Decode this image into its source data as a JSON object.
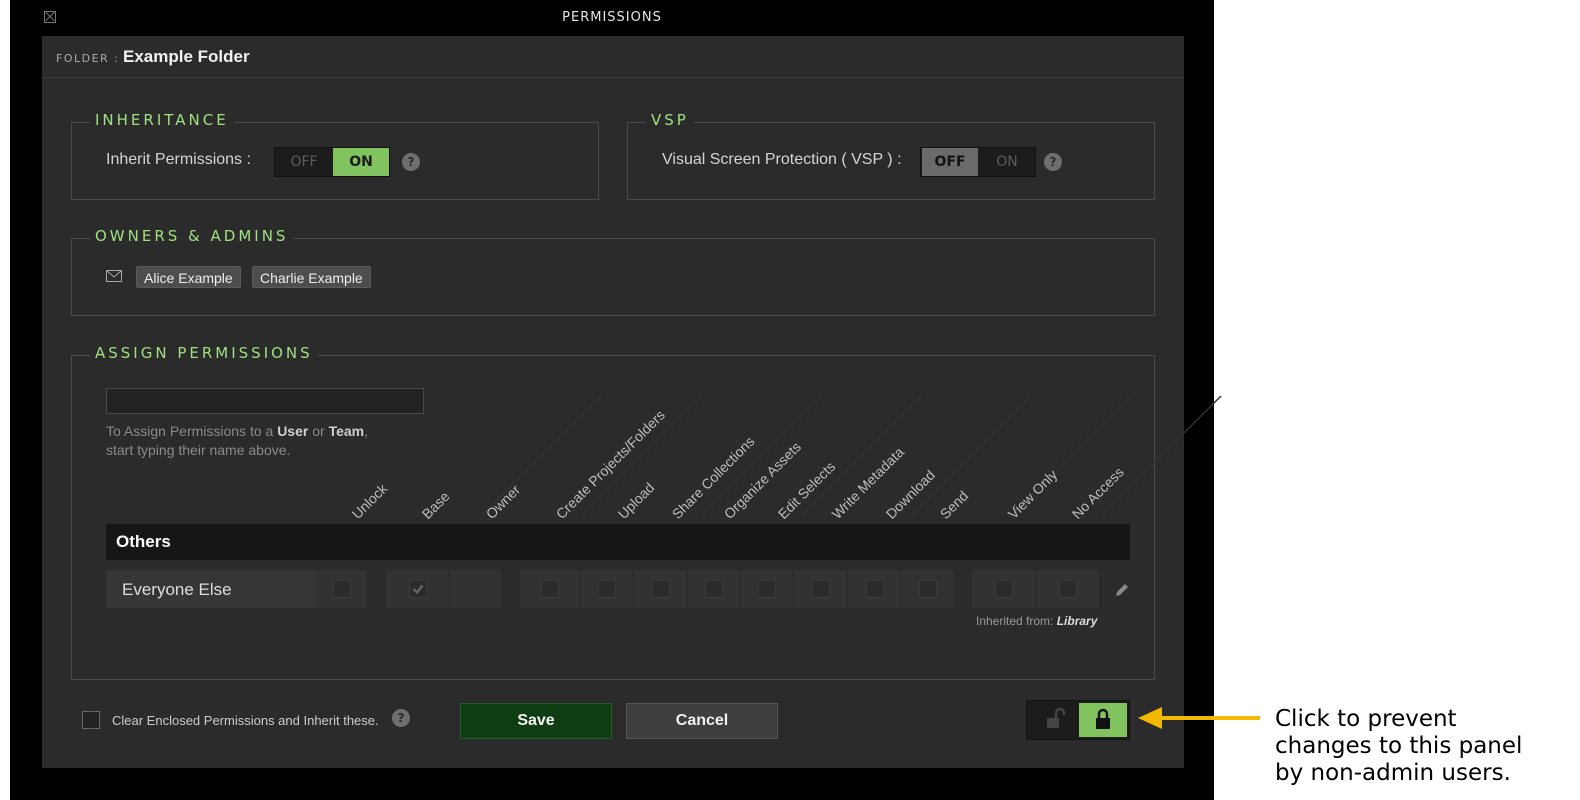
{
  "window": {
    "title": "PERMISSIONS"
  },
  "folder": {
    "key": "FOLDER :",
    "name": "Example Folder"
  },
  "inheritance": {
    "legend": "INHERITANCE",
    "label": "Inherit Permissions :",
    "off": "OFF",
    "on": "ON",
    "state": "on"
  },
  "vsp": {
    "legend": "VSP",
    "label": "Visual Screen Protection ( VSP ) :",
    "off": "OFF",
    "on": "ON",
    "state": "off"
  },
  "owners": {
    "legend": "OWNERS & ADMINS",
    "chips": [
      "Alice Example",
      "Charlie Example"
    ]
  },
  "assign": {
    "legend": "ASSIGN PERMISSIONS",
    "search_placeholder": "",
    "hint_prefix": "To Assign Permissions to a ",
    "hint_user": "User",
    "hint_or": " or ",
    "hint_team": "Team",
    "hint_suffix": ",",
    "hint_line2": "start typing their name above.",
    "columns": [
      "Unlock",
      "Base",
      "Owner",
      "Create Projects/Folders",
      "Upload",
      "Share Collections",
      "Organize Assets",
      "Edit Selects",
      "Write Metadata",
      "Download",
      "Send",
      "View Only",
      "No Access"
    ],
    "group": "Others",
    "row": {
      "name": "Everyone Else",
      "checked": [
        "Base"
      ]
    },
    "inherited_prefix": "Inherited from: ",
    "inherited_from": "Library"
  },
  "footer": {
    "clear_label": "Clear Enclosed Permissions and Inherit these.",
    "save": "Save",
    "cancel": "Cancel",
    "lock_state": "locked"
  },
  "annotation": {
    "line1": "Click to prevent",
    "line2": "changes to this panel",
    "line3": "by non-admin users."
  },
  "colors": {
    "accent": "#80c35f",
    "save_bg": "#0f3d12",
    "annotation_arrow": "#f5b800"
  }
}
